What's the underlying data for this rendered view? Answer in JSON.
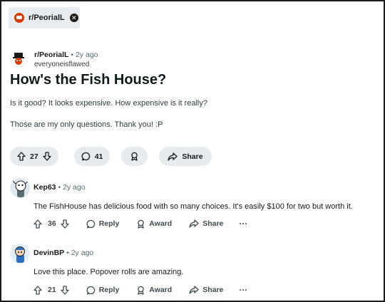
{
  "filter_chip": {
    "label": "r/PeorialL",
    "close_glyph": "✕"
  },
  "post": {
    "subreddit": "r/PeorialL",
    "age": "2y ago",
    "author": "everyoneisflawed",
    "title": "How's the Fish House?",
    "body": [
      "Is it good? It looks expensive. How expensive is it really?",
      "Those are my only questions. Thank you! :P"
    ],
    "actions": {
      "votes": "27",
      "comments": "41",
      "share_label": "Share",
      "award_icon": "award-icon"
    }
  },
  "comments": [
    {
      "author": "Kep63",
      "age": "2y ago",
      "text": "The FishHouse has delicious food with so many choices. It's easily $100 for two but worth it.",
      "votes": "36",
      "reply_label": "Reply",
      "award_label": "Award",
      "share_label": "Share",
      "more_label": "···"
    },
    {
      "author": "DevinBP",
      "age": "2y ago",
      "text": "Love this place. Popover rolls are amazing.",
      "votes": "21",
      "reply_label": "Reply",
      "award_label": "Award",
      "share_label": "Share",
      "more_label": "···"
    }
  ],
  "separator": "•",
  "colors": {
    "brand": "#d93a00",
    "pill_bg": "#e5ebee",
    "chip_bg": "#e8ecef",
    "muted": "#576f76"
  }
}
